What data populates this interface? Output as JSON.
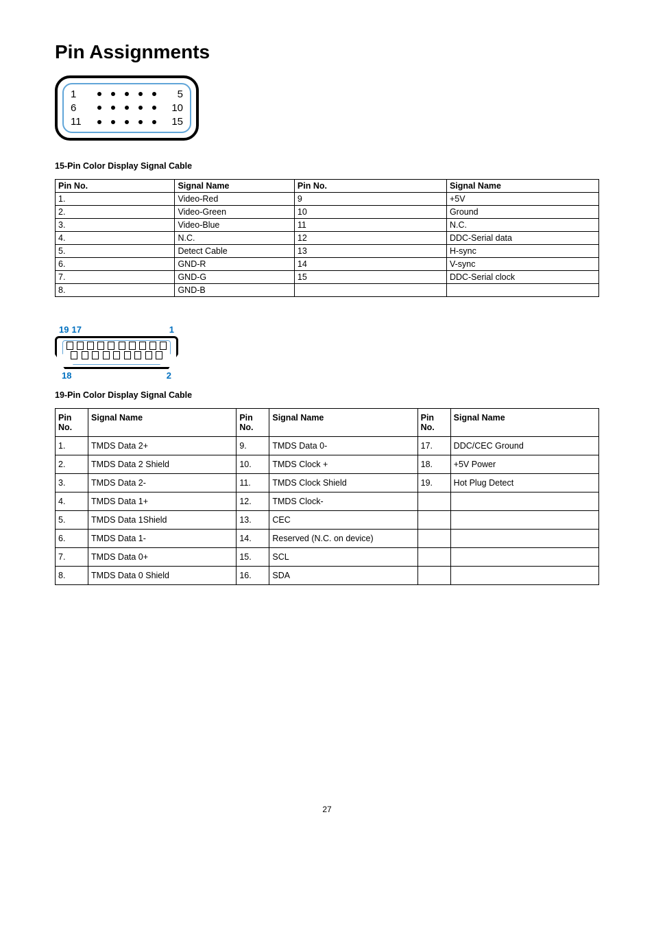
{
  "title": "Pin Assignments",
  "connector15": {
    "labels": {
      "r1l": "1",
      "r1r": "5",
      "r2l": "6",
      "r2r": "10",
      "r3l": "11",
      "r3r": "15"
    }
  },
  "section15_label": "15-Pin Color Display Signal Cable",
  "table15": {
    "headers": [
      "Pin No.",
      "Signal Name",
      "Pin No.",
      "Signal Name"
    ],
    "rows": [
      [
        "1.",
        "Video-Red",
        "9",
        "+5V"
      ],
      [
        "2.",
        "Video-Green",
        "10",
        "Ground"
      ],
      [
        "3.",
        "Video-Blue",
        "11",
        "N.C."
      ],
      [
        "4.",
        "N.C.",
        "12",
        "DDC-Serial data"
      ],
      [
        "5.",
        "Detect Cable",
        "13",
        "H-sync"
      ],
      [
        "6.",
        "GND-R",
        "14",
        "V-sync"
      ],
      [
        "7.",
        "GND-G",
        "15",
        "DDC-Serial clock"
      ],
      [
        "8.",
        "GND-B",
        "",
        ""
      ]
    ]
  },
  "hdmi_labels": {
    "t1": "19",
    "t2": "17",
    "t3": "1",
    "b1": "18",
    "b2": "2"
  },
  "section19_label": "19-Pin Color Display Signal Cable",
  "table19": {
    "headers": [
      "Pin No.",
      "Signal Name",
      "Pin No.",
      "Signal Name",
      "Pin No.",
      "Signal Name"
    ],
    "rows": [
      [
        "1.",
        "TMDS Data 2+",
        "9.",
        "TMDS Data 0-",
        "17.",
        "DDC/CEC Ground"
      ],
      [
        "2.",
        "TMDS Data 2 Shield",
        "10.",
        "TMDS Clock +",
        "18.",
        "+5V Power"
      ],
      [
        "3.",
        "TMDS Data 2-",
        "11.",
        "TMDS Clock Shield",
        "19.",
        "Hot Plug Detect"
      ],
      [
        "4.",
        "TMDS Data 1+",
        "12.",
        "TMDS Clock-",
        "",
        ""
      ],
      [
        "5.",
        "TMDS Data 1Shield",
        "13.",
        "CEC",
        "",
        ""
      ],
      [
        "6.",
        "TMDS Data 1-",
        "14.",
        "Reserved (N.C. on device)",
        "",
        ""
      ],
      [
        "7.",
        "TMDS Data 0+",
        "15.",
        "SCL",
        "",
        ""
      ],
      [
        "8.",
        "TMDS Data 0 Shield",
        "16.",
        "SDA",
        "",
        ""
      ]
    ]
  },
  "page_number": "27"
}
